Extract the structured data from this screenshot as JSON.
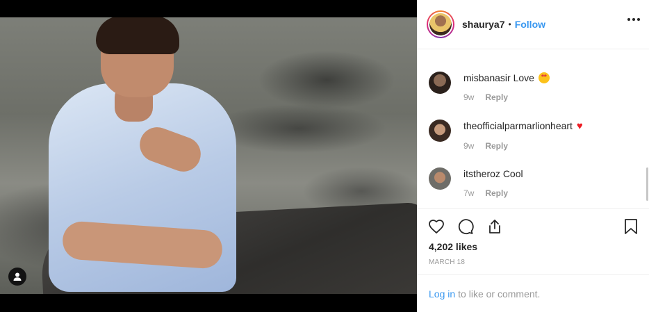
{
  "post": {
    "author": "shaurya7",
    "separator": "•",
    "follow_label": "Follow"
  },
  "comments": [
    {
      "user": "misbanasir",
      "text": "Love",
      "emoji": "star-struck",
      "age": "9w",
      "reply_label": "Reply"
    },
    {
      "user": "theofficialparmarlionheart",
      "text": "",
      "emoji": "red-heart",
      "age": "9w",
      "reply_label": "Reply"
    },
    {
      "user": "itstheroz",
      "text": "Cool",
      "emoji": "",
      "age": "7w",
      "reply_label": "Reply"
    }
  ],
  "actions": {
    "likes": "4,202 likes",
    "date": "MARCH 18"
  },
  "login": {
    "link_label": "Log in",
    "suffix": "to like or comment."
  },
  "colors": {
    "link_blue": "#3897f0",
    "text": "#262626",
    "muted": "#999999",
    "heart_red": "#ed1c24"
  },
  "icons": [
    "user-tag-icon",
    "more-options-icon",
    "heart-icon",
    "comment-icon",
    "share-icon",
    "bookmark-icon"
  ]
}
